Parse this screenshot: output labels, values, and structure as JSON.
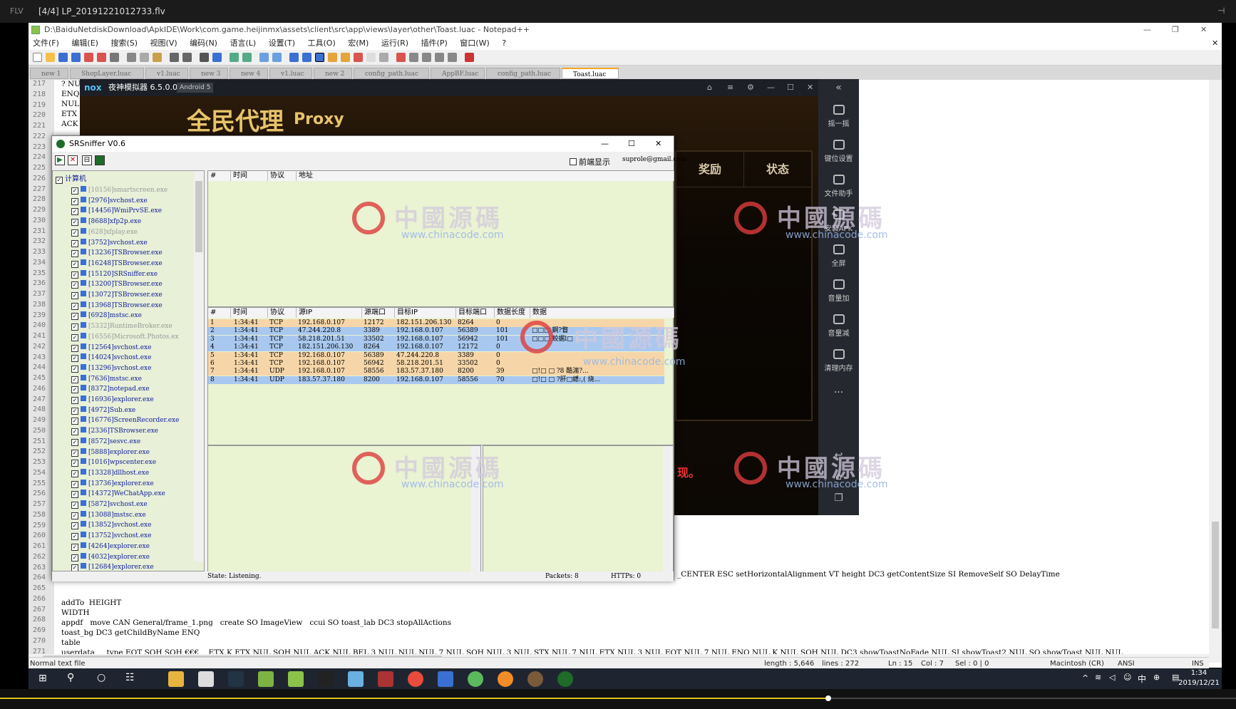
{
  "player": {
    "label": "FLV",
    "title": "[4/4] LP_20191221012733.flv"
  },
  "npp": {
    "title": "D:\\BaiduNetdiskDownload\\ApkIDE\\Work\\com.game.heijinmx\\assets\\client\\src\\app\\views\\layer\\other\\Toast.luac - Notepad++",
    "menu": [
      "文件(F)",
      "编辑(E)",
      "搜索(S)",
      "视图(V)",
      "编码(N)",
      "语言(L)",
      "设置(T)",
      "工具(O)",
      "宏(M)",
      "运行(R)",
      "插件(P)",
      "窗口(W)",
      "?"
    ],
    "tabs": [
      "new 1",
      "ShopLayer.luac",
      "v1.luac",
      "new 3",
      "new 4",
      "v1.luac",
      "new 2",
      "config_path.luac",
      "AppBF.luac",
      "config_path.luac",
      "Toast.luac"
    ],
    "lines": [
      {
        "n": "217",
        "text": "? NUL"
      },
      {
        "n": "218",
        "text": "ENQ"
      },
      {
        "n": "219",
        "text": "NUL"
      },
      {
        "n": "220",
        "text": "ETX"
      },
      {
        "n": "221",
        "text": "ACK"
      },
      {
        "n": "267",
        "text": "addTo  HEIGHT"
      },
      {
        "n": "268",
        "text": "WIDTH"
      },
      {
        "n": "269",
        "text": "appdf   move CAN General/frame_1.png   create SO ImageView   ccui SO toast_lab DC3 stopAllActions"
      },
      {
        "n": "270",
        "text": "toast_bg DC3 getChildByName ENQ"
      },
      {
        "n": "271",
        "text": "table"
      },
      {
        "n": "272",
        "text": "userdata     type EOT SOH SOH €€€    ETX K ETX NUL SOH NUL ACK NUL BEL 3 NUL NUL NUL 7 NUL SOH NUL 3 NUL STX NUL 7 NUL ETX NUL 3 NUL EOT NUL 7 NUL ENQ NUL K NUL SOH NUL DC3 showToastNoFade NUL SI showToast2 NUL SO showToast NUL NUL"
      }
    ],
    "line266_tail": "_CENTER ESC setHorizontalAlignment VT height DC3 getContentSize SI RemoveSelf SO DelayTime",
    "linenums": [
      "217",
      "218",
      "219",
      "220",
      "221",
      "222",
      "223",
      "224",
      "225",
      "226",
      "227",
      "228",
      "229",
      "230",
      "231",
      "232",
      "233",
      "234",
      "235",
      "236",
      "237",
      "238",
      "239",
      "240",
      "241",
      "242",
      "243",
      "244",
      "245",
      "246",
      "247",
      "248",
      "249",
      "250",
      "251",
      "252",
      "253",
      "254",
      "255",
      "256",
      "257",
      "258",
      "259",
      "260",
      "261",
      "262",
      "263",
      "264",
      "265",
      "266",
      "267",
      "268",
      "269",
      "270",
      "271",
      "272"
    ],
    "status": {
      "filetype": "Normal text file",
      "length": "length : 5,646",
      "lines": "lines : 272",
      "ln": "Ln : 15",
      "col": "Col : 7",
      "sel": "Sel : 0 | 0",
      "eol": "Macintosh (CR)",
      "encoding": "ANSI",
      "mode": "INS"
    }
  },
  "nox": {
    "title": "夜神模拟器 6.5.0.0",
    "android": "Android 5",
    "game_title": "全民代理",
    "game_sub": "Proxy",
    "tabs": [
      "奖励",
      "状态"
    ],
    "side": [
      "摇一摇",
      "键位设置",
      "文件助手",
      "安装APK",
      "全屏",
      "音量加",
      "音量减",
      "清理内存",
      "..."
    ],
    "red_text": "现。"
  },
  "sniffer": {
    "title": "SRSniffer V0.6",
    "front_display": "前端显示",
    "email": "suprole@gmail.com",
    "tree_root": "计算机",
    "processes": [
      {
        "name": "[10156]smartscreen.exe",
        "grey": true
      },
      {
        "name": "[2976]svchost.exe",
        "grey": false
      },
      {
        "name": "[14456]WmiPrvSE.exe",
        "grey": false
      },
      {
        "name": "[8688]xfp2p.exe",
        "grey": false
      },
      {
        "name": "[628]xfplay.exe",
        "grey": true
      },
      {
        "name": "[3752]svchost.exe",
        "grey": false
      },
      {
        "name": "[13236]TSBrowser.exe",
        "grey": false
      },
      {
        "name": "[16248]TSBrowser.exe",
        "grey": false
      },
      {
        "name": "[15120]SRSniffer.exe",
        "grey": false
      },
      {
        "name": "[13200]TSBrowser.exe",
        "grey": false
      },
      {
        "name": "[13072]TSBrowser.exe",
        "grey": false
      },
      {
        "name": "[13968]TSBrowser.exe",
        "grey": false
      },
      {
        "name": "[6928]mstsc.exe",
        "grey": false
      },
      {
        "name": "[5332]RuntimeBroker.exe",
        "grey": true
      },
      {
        "name": "[16556]Microsoft.Photos.ex",
        "grey": true
      },
      {
        "name": "[12564]svchost.exe",
        "grey": false
      },
      {
        "name": "[14024]svchost.exe",
        "grey": false
      },
      {
        "name": "[13296]svchost.exe",
        "grey": false
      },
      {
        "name": "[7636]mstsc.exe",
        "grey": false
      },
      {
        "name": "[8372]notepad.exe",
        "grey": false
      },
      {
        "name": "[16936]explorer.exe",
        "grey": false
      },
      {
        "name": "[4972]Sub.exe",
        "grey": false
      },
      {
        "name": "[16776]ScreenRecorder.exe",
        "grey": false
      },
      {
        "name": "[2336]TSBrowser.exe",
        "grey": false
      },
      {
        "name": "[8572]sesvc.exe",
        "grey": false
      },
      {
        "name": "[5888]explorer.exe",
        "grey": false
      },
      {
        "name": "[1016]wpscenter.exe",
        "grey": false
      },
      {
        "name": "[13328]dllhost.exe",
        "grey": false
      },
      {
        "name": "[13736]explorer.exe",
        "grey": false
      },
      {
        "name": "[14372]WeChatApp.exe",
        "grey": false
      },
      {
        "name": "[5872]svchost.exe",
        "grey": false
      },
      {
        "name": "[13088]mstsc.exe",
        "grey": false
      },
      {
        "name": "[13852]svchost.exe",
        "grey": false
      },
      {
        "name": "[13752]svchost.exe",
        "grey": false
      },
      {
        "name": "[4264]explorer.exe",
        "grey": false
      },
      {
        "name": "[4032]explorer.exe",
        "grey": false
      },
      {
        "name": "[12684]explorer.exe",
        "grey": false
      }
    ],
    "top_headers": [
      "#",
      "时间",
      "协议",
      "地址"
    ],
    "pkt_headers": [
      "#",
      "时间",
      "协议",
      "源IP",
      "源端口",
      "目标IP",
      "目标端口",
      "数据长度",
      "数据"
    ],
    "packets": [
      {
        "n": "1",
        "time": "1:34:41",
        "proto": "TCP",
        "src": "192.168.0.107",
        "sport": "12172",
        "dst": "182.151.206.130",
        "dport": "8264",
        "len": "0",
        "data": "",
        "bg": "#f6d6a8"
      },
      {
        "n": "2",
        "time": "1:34:41",
        "proto": "TCP",
        "src": "47.244.220.8",
        "sport": "3389",
        "dst": "192.168.0.107",
        "dport": "56389",
        "len": "101",
        "data": "□□□  鋼?瞀   ",
        "bg": "#a9c8ef"
      },
      {
        "n": "3",
        "time": "1:34:41",
        "proto": "TCP",
        "src": "58.218.201.51",
        "sport": "33502",
        "dst": "192.168.0.107",
        "dport": "56942",
        "len": "101",
        "data": "□□□  鲛据l□",
        "bg": "#a9c8ef"
      },
      {
        "n": "4",
        "time": "1:34:41",
        "proto": "TCP",
        "src": "182.151.206.130",
        "sport": "8264",
        "dst": "192.168.0.107",
        "dport": "12172",
        "len": "0",
        "data": "",
        "bg": "#a9c8ef"
      },
      {
        "n": "5",
        "time": "1:34:41",
        "proto": "TCP",
        "src": "192.168.0.107",
        "sport": "56389",
        "dst": "47.244.220.8",
        "dport": "3389",
        "len": "0",
        "data": "",
        "bg": "#f6d6a8"
      },
      {
        "n": "6",
        "time": "1:34:41",
        "proto": "TCP",
        "src": "192.168.0.107",
        "sport": "56942",
        "dst": "58.218.201.51",
        "dport": "33502",
        "len": "0",
        "data": "",
        "bg": "#f6d6a8"
      },
      {
        "n": "7",
        "time": "1:34:41",
        "proto": "UDP",
        "src": "192.168.0.107",
        "sport": "58556",
        "dst": "183.57.37.180",
        "dport": "8200",
        "len": "39",
        "data": "□!□  □   ?8   酷湍?...",
        "bg": "#f6d6a8"
      },
      {
        "n": "8",
        "time": "1:34:41",
        "proto": "UDP",
        "src": "183.57.37.180",
        "sport": "8200",
        "dst": "192.168.0.107",
        "dport": "58556",
        "len": "70",
        "data": "□!□  □ ?肝□蟋:,( 烧...",
        "bg": "#a9c8ef"
      }
    ],
    "status": "State: Listening.",
    "packets_count": "Packets: 8",
    "https_count": "HTTPs: 0"
  },
  "watermark": {
    "text": "中國源碼",
    "url": "www.chinacode.com"
  },
  "taskbar": {
    "time": "1:34",
    "date": "2019/12/21",
    "ime": "中"
  },
  "colors": {
    "player_bg": "#1b1b1b",
    "nox_title": "#1c1f26",
    "sniffer_green": "#eaf3d2",
    "row_out": "#f6d6a8",
    "row_in": "#a9c8ef",
    "taskbar": "#1e2530"
  }
}
